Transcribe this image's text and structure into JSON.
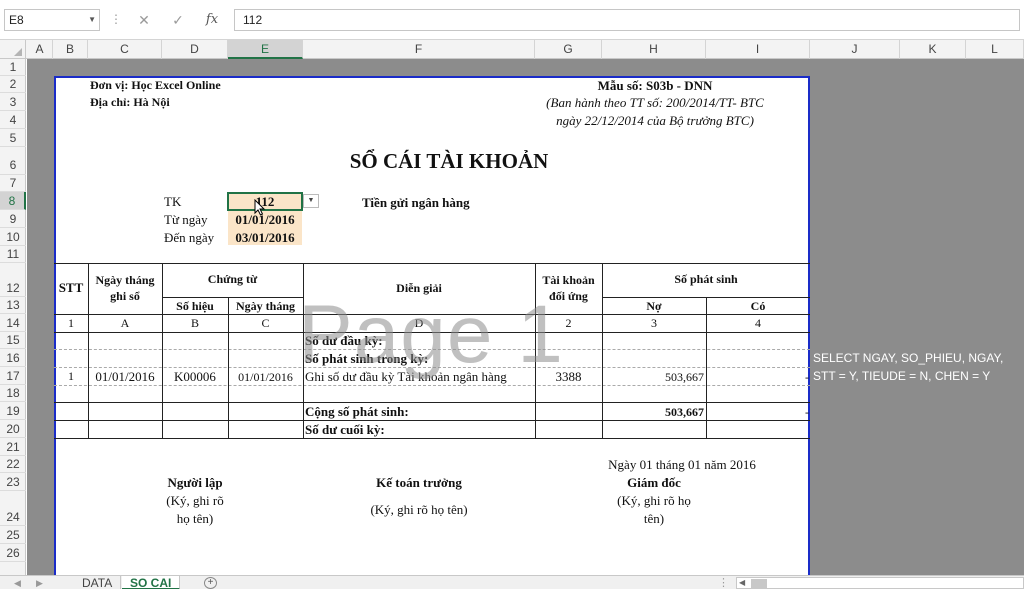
{
  "formula_bar": {
    "name_box": "E8",
    "cancel_glyph": "✕",
    "enter_glyph": "✓",
    "fx_glyph": "fx",
    "formula": "112"
  },
  "columns": [
    "A",
    "B",
    "C",
    "D",
    "E",
    "F",
    "G",
    "H",
    "I",
    "J",
    "K",
    "L"
  ],
  "rows": [
    "1",
    "2",
    "3",
    "4",
    "5",
    "6",
    "7",
    "8",
    "9",
    "10",
    "11",
    "12",
    "13",
    "14",
    "15",
    "16",
    "17",
    "18",
    "19",
    "20",
    "21",
    "22",
    "23",
    "24",
    "25",
    "26"
  ],
  "header": {
    "unit": "Đơn vị: Học Excel Online",
    "address": "Địa chỉ: Hà Nội",
    "form_no": "Mẫu số: S03b - DNN",
    "issued_line1": "(Ban hành theo TT số: 200/2014/TT- BTC",
    "issued_line2": "ngày 22/12/2014 của Bộ trưởng BTC)"
  },
  "title": "SỔ CÁI TÀI KHOẢN",
  "params": {
    "tk_label": "TK",
    "tk_value": "112",
    "tk_name": "Tiền gửi ngân hàng",
    "from_label": "Từ ngày",
    "from_value": "01/01/2016",
    "to_label": "Đến ngày",
    "to_value": "03/01/2016"
  },
  "table": {
    "stt": "STT",
    "ngay_ghi_so_1": "Ngày tháng",
    "ngay_ghi_so_2": "ghi sổ",
    "chung_tu": "Chứng từ",
    "so_hieu": "Số hiệu",
    "ngay_thang": "Ngày tháng",
    "dien_giai": "Diễn giải",
    "tk_doi_ung_1": "Tài khoản",
    "tk_doi_ung_2": "đối ứng",
    "so_phat_sinh": "Số phát sinh",
    "no": "Nợ",
    "co": "Có",
    "index_row": [
      "1",
      "A",
      "B",
      "C",
      "D",
      "2",
      "3",
      "4"
    ],
    "so_du_dau_ky": "Số dư đầu kỳ:",
    "so_phat_sinh_trong_ky": "Số phát sinh trong kỳ:",
    "entry": {
      "stt": "1",
      "ngay_ghi_so": "01/01/2016",
      "so_hieu": "K00006",
      "ngay_thang": "01/01/2016",
      "dien_giai": "Ghi số dư đầu kỳ Tài khoản ngân hàng",
      "tk_doi_ung": "3388",
      "no": "503,667",
      "co": "-"
    },
    "cong_so_phat_sinh": "Cộng số phát sinh:",
    "cong_no": "503,667",
    "cong_co": "-",
    "so_du_cuoi_ky": "Số dư cuối kỳ:"
  },
  "signatures": {
    "date_line": "Ngày 01 tháng 01 năm 2016",
    "nguoi_lap": "Người lập",
    "nguoi_lap_note1": "(Ký, ghi rõ",
    "nguoi_lap_note2": "họ tên)",
    "ke_toan": "Kế toán trưởng",
    "ke_toan_note": "(Ký, ghi rõ họ tên)",
    "giam_doc": "Giám đốc",
    "giam_doc_note1": "(Ký, ghi rõ họ",
    "giam_doc_note2": "tên)"
  },
  "watermark": "Page 1",
  "sql_text": {
    "line1": "SELECT NGAY, SO_PHIEU, NGAY,",
    "line2": "STT = Y, TIEUDE = N, CHEN = Y"
  },
  "sheet_tabs": [
    "DATA",
    "SO CAI"
  ],
  "active_tab": "SO CAI",
  "add_sheet": "+",
  "colors": {
    "page_border": "#1a2cc8",
    "grid_bg": "#8c8c8c",
    "highlight": "#fbe5c8",
    "excel_green": "#217346"
  }
}
